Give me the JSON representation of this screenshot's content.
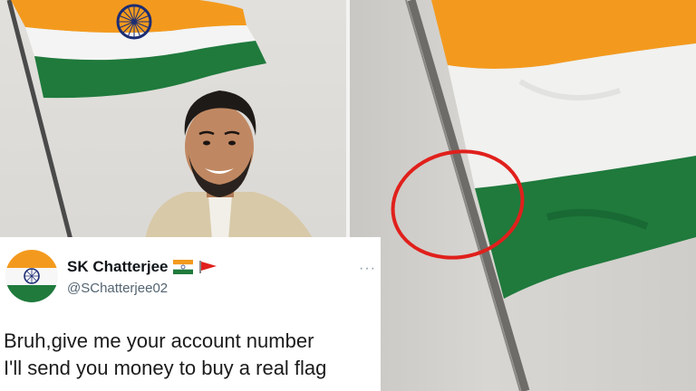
{
  "left_photo": {
    "description_icon": "man-in-front-of-flag"
  },
  "right_photo": {
    "annotation": "red-circle-around-gap"
  },
  "tweet": {
    "display_name": "SK Chatterjee",
    "handle": "@SChatterjee02",
    "more_label": "···",
    "lines": [
      "Bruh,give me your account number",
      "I'll send you money to buy a real flag"
    ],
    "emoji_flags": [
      "india-flag-icon",
      "red-pennant-icon"
    ]
  },
  "colors": {
    "saffron": "#f39a1e",
    "white": "#f4f4f4",
    "green": "#1f7a3c",
    "chakra": "#1c2d74",
    "annotation_red": "#e0201c"
  }
}
